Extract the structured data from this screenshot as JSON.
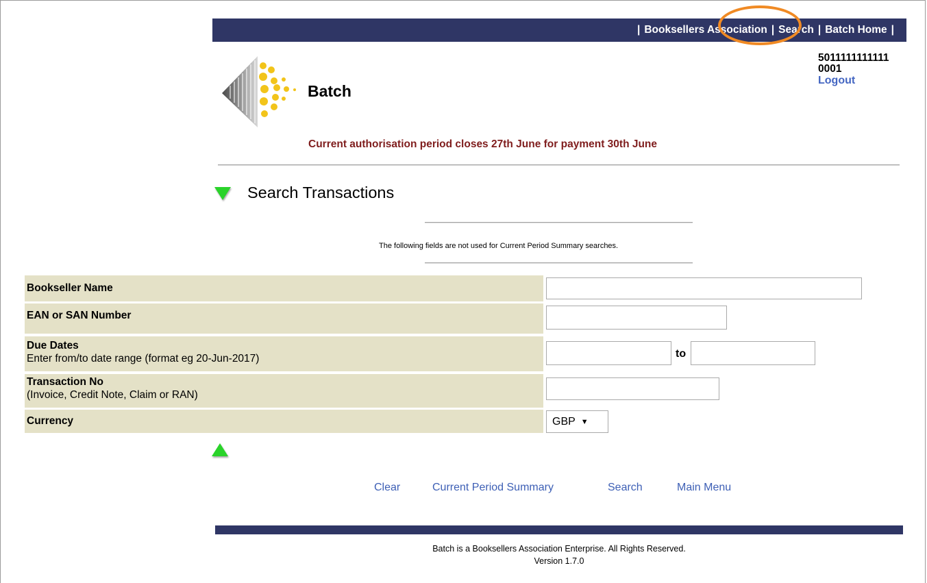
{
  "header": {
    "nav_links": [
      {
        "label": "Booksellers Association"
      },
      {
        "label": "Search"
      },
      {
        "label": "Batch Home"
      }
    ],
    "brand": "Batch",
    "account": {
      "line1": "5011111111111",
      "line2": "0001",
      "logout_label": "Logout"
    },
    "notice": "Current authorisation period closes 27th June for payment 30th June"
  },
  "section": {
    "title": "Search Transactions",
    "note": "The following fields are not used for Current Period Summary searches."
  },
  "form": {
    "bookseller_name": {
      "label": "Bookseller Name",
      "value": ""
    },
    "ean_san": {
      "label": "EAN or SAN Number",
      "value": ""
    },
    "due_dates": {
      "label": "Due Dates",
      "hint": "Enter from/to date range (format eg 20-Jun-2017)",
      "from_value": "",
      "to_label": "to",
      "to_value": ""
    },
    "transaction_no": {
      "label": "Transaction No",
      "hint": "(Invoice, Credit Note, Claim or RAN)",
      "value": ""
    },
    "currency": {
      "label": "Currency",
      "selected": "GBP"
    }
  },
  "actions": {
    "clear": "Clear",
    "current_period_summary": "Current Period Summary",
    "search": "Search",
    "main_menu": "Main Menu"
  },
  "footer": {
    "line1": "Batch is a Booksellers Association Enterprise. All Rights Reserved.",
    "line2": "Version 1.7.0"
  },
  "colors": {
    "nav_bar": "#2f3665",
    "notice": "#7f1d1d",
    "form_label_bg": "#e4e1c7",
    "link": "#3d5fb5",
    "triangle": "#2ad32a",
    "highlight": "#f08a24"
  }
}
